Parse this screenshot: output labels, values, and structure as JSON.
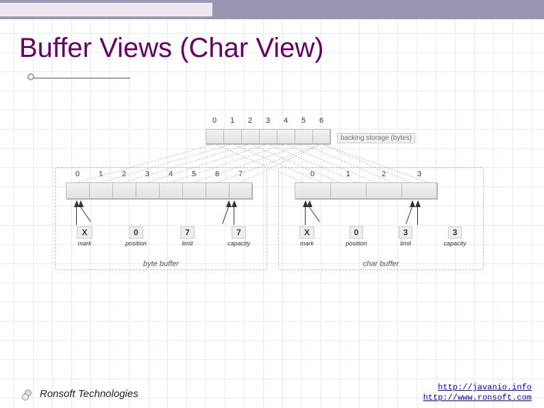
{
  "slide": {
    "title": "Buffer Views (Char View)"
  },
  "backing": {
    "label": "backing storage (bytes)",
    "indices": [
      "0",
      "1",
      "2",
      "3",
      "4",
      "5",
      "6"
    ]
  },
  "byte_buffer": {
    "indices": [
      "0",
      "1",
      "2",
      "3",
      "4",
      "5",
      "6",
      "7"
    ],
    "label": "byte buffer",
    "props": {
      "mark": {
        "val": "X",
        "lbl": "mark"
      },
      "position": {
        "val": "0",
        "lbl": "position"
      },
      "limit": {
        "val": "7",
        "lbl": "limit"
      },
      "capacity": {
        "val": "7",
        "lbl": "capacity"
      }
    }
  },
  "char_buffer": {
    "indices": [
      "0",
      "1",
      "2",
      "3"
    ],
    "label": "char buffer",
    "props": {
      "mark": {
        "val": "X",
        "lbl": "mark"
      },
      "position": {
        "val": "0",
        "lbl": "position"
      },
      "limit": {
        "val": "3",
        "lbl": "limit"
      },
      "capacity": {
        "val": "3",
        "lbl": "capacity"
      }
    }
  },
  "footer": {
    "company": "Ronsoft Technologies",
    "link1": "http://javanio.info",
    "link2": "http://www.ronsoft.com"
  }
}
